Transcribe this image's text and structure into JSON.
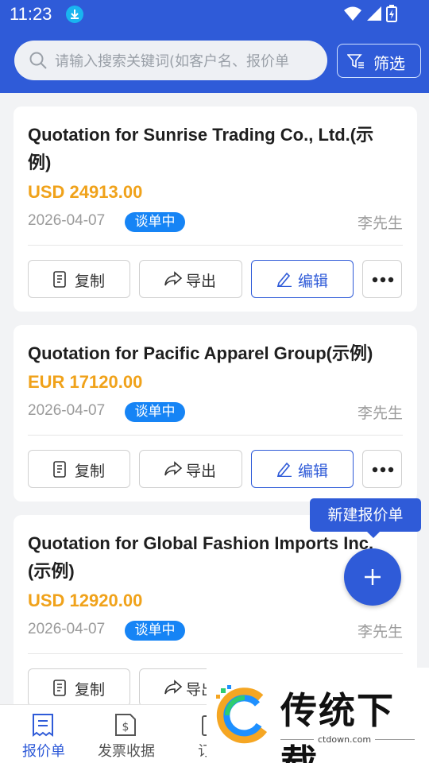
{
  "status_bar": {
    "time": "11:23"
  },
  "search": {
    "placeholder": "请输入搜索关键词(如客户名、报价单"
  },
  "filter": {
    "label": "筛选"
  },
  "quotes": [
    {
      "title": "Quotation for Sunrise Trading Co., Ltd.(示例)",
      "amount": "USD 24913.00",
      "date": "2026-04-07",
      "status": "谈单中",
      "owner": "李先生"
    },
    {
      "title": "Quotation for Pacific Apparel Group(示例)",
      "amount": "EUR 17120.00",
      "date": "2026-04-07",
      "status": "谈单中",
      "owner": "李先生"
    },
    {
      "title": "Quotation for Global Fashion Imports Inc.(示例)",
      "amount": "USD 12920.00",
      "date": "2026-04-07",
      "status": "谈单中",
      "owner": "李先生"
    }
  ],
  "actions": {
    "copy": "复制",
    "export": "导出",
    "edit": "编辑"
  },
  "fab": {
    "tooltip": "新建报价单"
  },
  "bottom_nav": [
    {
      "label": "报价单",
      "icon": "receipt-icon",
      "active": true
    },
    {
      "label": "发票收据",
      "icon": "invoice-icon",
      "active": false
    },
    {
      "label": "订货",
      "icon": "order-icon",
      "active": false
    }
  ],
  "watermark": {
    "text": "传统下载",
    "url": "ctdown.com"
  },
  "colors": {
    "primary": "#2f5bd8",
    "amount": "#f0a21a",
    "badge": "#1684f5"
  }
}
